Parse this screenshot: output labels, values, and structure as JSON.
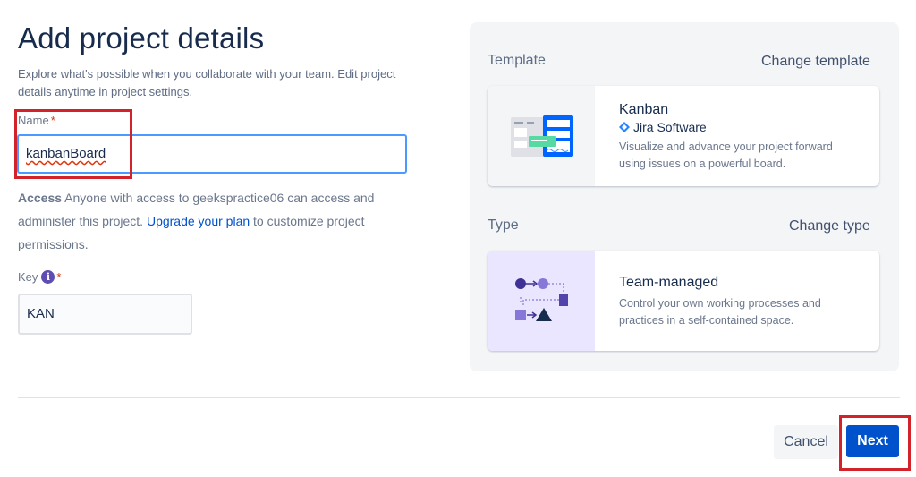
{
  "page": {
    "title": "Add project details",
    "subtitle": "Explore what's possible when you collaborate with your team. Edit project details anytime in project settings."
  },
  "name_field": {
    "label": "Name",
    "required": "*",
    "value": "kanbanBoard"
  },
  "access": {
    "label": "Access",
    "text1": " Anyone with access to geekspractice06 can access and administer this project. ",
    "link": "Upgrade your plan",
    "text2": " to customize project permissions."
  },
  "key_field": {
    "label": "Key",
    "info": "i",
    "required": "*",
    "value": "KAN"
  },
  "template": {
    "section_label": "Template",
    "change_link": "Change template",
    "card": {
      "title": "Kanban",
      "product": "Jira Software",
      "description": "Visualize and advance your project forward using issues on a powerful board."
    }
  },
  "type": {
    "section_label": "Type",
    "change_link": "Change type",
    "card": {
      "title": "Team-managed",
      "description": "Control your own working processes and practices in a self-contained space."
    }
  },
  "buttons": {
    "cancel": "Cancel",
    "next": "Next"
  },
  "colors": {
    "primary": "#0052cc",
    "focus": "#4c9aff",
    "annotation": "#d2232a",
    "type_bg": "#eae6ff"
  }
}
